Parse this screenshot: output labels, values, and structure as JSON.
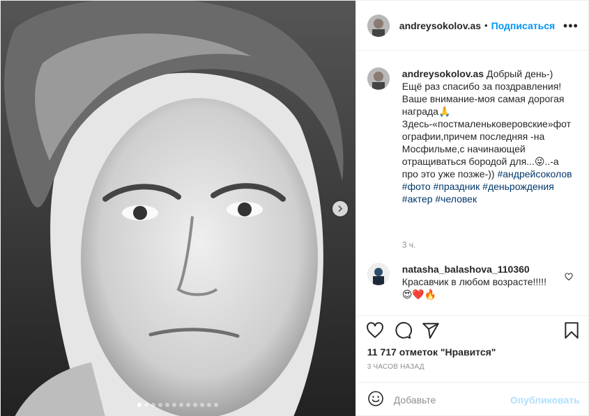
{
  "carousel": {
    "total_images": 12,
    "active_index": 0
  },
  "header": {
    "username": "andreysokolov.as",
    "separator": "•",
    "follow_label": "Подписаться",
    "more_label": "•••"
  },
  "caption": {
    "username": "andreysokolov.as",
    "text": " Добрый день-)\nЕщё раз спасибо за поздравления!\nВаше внимание-моя самая дорогая награда🙏\nЗдесь-«постмаленьковеровские»фотографии,причем последняя -на Мосфильме,с начинающей отращиваться бородой для...😜..-а про это уже позже-))",
    "hashtags": [
      "#андрейсоколов",
      "#фото",
      "#праздник",
      "#деньрождения",
      "#актер",
      "#человек"
    ],
    "time": "3 ч."
  },
  "comment": {
    "username": "natasha_balashova_110360",
    "text": "Красавчик в любом возрасте!!!!!😍❤️🔥"
  },
  "actions": {
    "icons": [
      "heart-icon",
      "comment-icon",
      "share-icon",
      "bookmark-icon"
    ]
  },
  "likes": "11 717 отметок \"Нравится\"",
  "posted_ago": "3 часов назад",
  "add_comment": {
    "placeholder": "Добавьте",
    "publish_label": "Опубликовать"
  }
}
